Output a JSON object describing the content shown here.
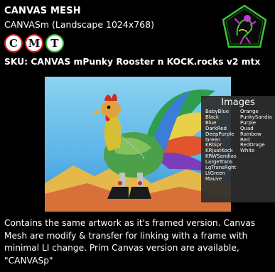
{
  "header": {
    "title": "CANVAS MESH",
    "subtitle": "CANVASm (Landscape 1024x768)",
    "badges": [
      "C",
      "M",
      "T"
    ],
    "sku": "SKU: CANVAS mPunky Rooster n KOCK.rocks v2 mtx"
  },
  "images_panel": {
    "title": "Images",
    "col1": [
      "BabyBlue",
      "Black",
      "Blue",
      "DarkRed",
      "DeepPurple",
      "Green",
      "KRbipr",
      "KRjustKock",
      "KRWSandias",
      "LargeTrans",
      "LgTransRght",
      "LtGreen",
      "Mauve"
    ],
    "col2": [
      "Orange",
      "PunkySandia",
      "Purple",
      "Quad",
      "Rainbow",
      "Red",
      "RedOrage",
      "White"
    ]
  },
  "description": "Contains the same artwork as it's framed version. Canvas Mesh are modify & transfer for linking with a frame with minimal LI change. Prim Canvas version are available, \"CANVASp\"",
  "colors": {
    "background": "#000000",
    "badge_red": "#e01818",
    "badge_green": "#2fae3a",
    "logo_green": "#39c437",
    "panel_bg": "#2d2d2d"
  }
}
